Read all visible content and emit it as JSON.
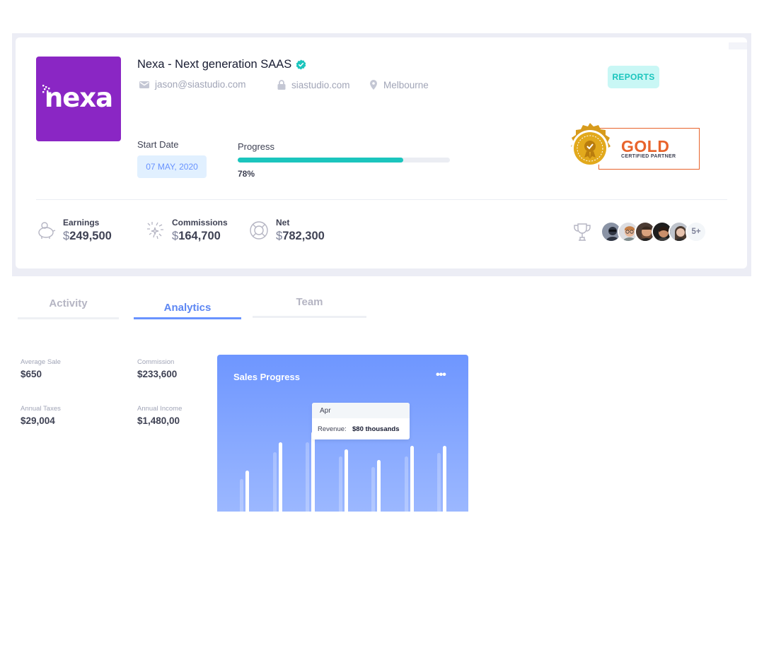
{
  "company": {
    "logo_text": "nexa",
    "name": "Nexa - Next generation SAAS",
    "email": "jason@siastudio.com",
    "website": "siastudio.com",
    "location": "Melbourne"
  },
  "actions": {
    "reports_label": "REPORTS"
  },
  "start_date": {
    "label": "Start Date",
    "value": "07 MAY, 2020"
  },
  "progress": {
    "label": "Progress",
    "value_text": "78%",
    "value": 78
  },
  "badge": {
    "word": "GOLD",
    "subtitle": "CERTIFIED PARTNER"
  },
  "stats": [
    {
      "label": "Earnings",
      "currency": "$",
      "amount": "249,500",
      "icon": "piggy-bank-icon"
    },
    {
      "label": "Commissions",
      "currency": "$",
      "amount": "164,700",
      "icon": "confetti-icon"
    },
    {
      "label": "Net",
      "currency": "$",
      "amount": "782,300",
      "icon": "lifebuoy-icon"
    }
  ],
  "team": {
    "icon": "trophy-icon",
    "more_label": "5+"
  },
  "tabs": [
    {
      "label": "Activity",
      "active": false
    },
    {
      "label": "Analytics",
      "active": true
    },
    {
      "label": "Team",
      "active": false
    }
  ],
  "analytics": {
    "average_sale": {
      "label": "Average Sale",
      "value": "$650"
    },
    "commission": {
      "label": "Commission",
      "value": "$233,600"
    },
    "annual_taxes": {
      "label": "Annual Taxes",
      "value": "$29,004"
    },
    "annual_income": {
      "label": "Annual Income",
      "value": "$1,480,00"
    }
  },
  "sales_chart": {
    "title": "Sales Progress",
    "menu_label": "•••",
    "tooltip": {
      "month": "Apr",
      "label": "Revenue:",
      "value": "$80 thousands"
    }
  },
  "chart_data": {
    "type": "bar",
    "title": "Sales Progress",
    "series": [
      {
        "values": [
          60,
          100,
          115,
          90,
          75,
          95,
          95
        ]
      },
      {
        "values": [
          48,
          86,
          100,
          80,
          65,
          80,
          85
        ]
      }
    ],
    "ylim": [
      0,
      125
    ],
    "grid": false,
    "tooltip_category": "Apr"
  },
  "colors": {
    "brand": "#8a26c4",
    "accent": "#6993ff",
    "success": "#1bc5bd",
    "gold": "#e8632b"
  }
}
